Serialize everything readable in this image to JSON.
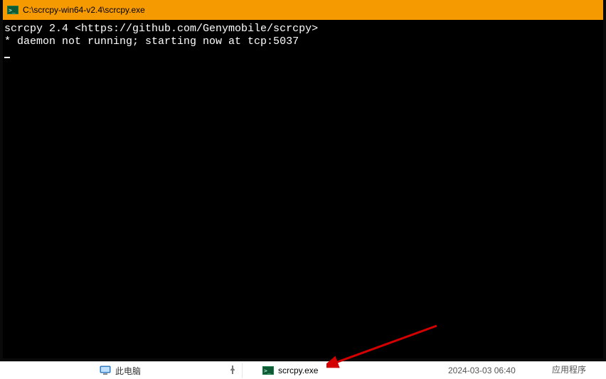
{
  "window": {
    "title": "C:\\scrcpy-win64-v2.4\\scrcpy.exe"
  },
  "console": {
    "line1": "scrcpy 2.4 <https://github.com/Genymobile/scrcpy>",
    "line2": "* daemon not running; starting now at tcp:5037"
  },
  "explorer": {
    "this_pc_label": "此电脑",
    "file_name": "scrcpy.exe",
    "file_date": "2024-03-03 06:40",
    "file_type": "应用程序"
  }
}
